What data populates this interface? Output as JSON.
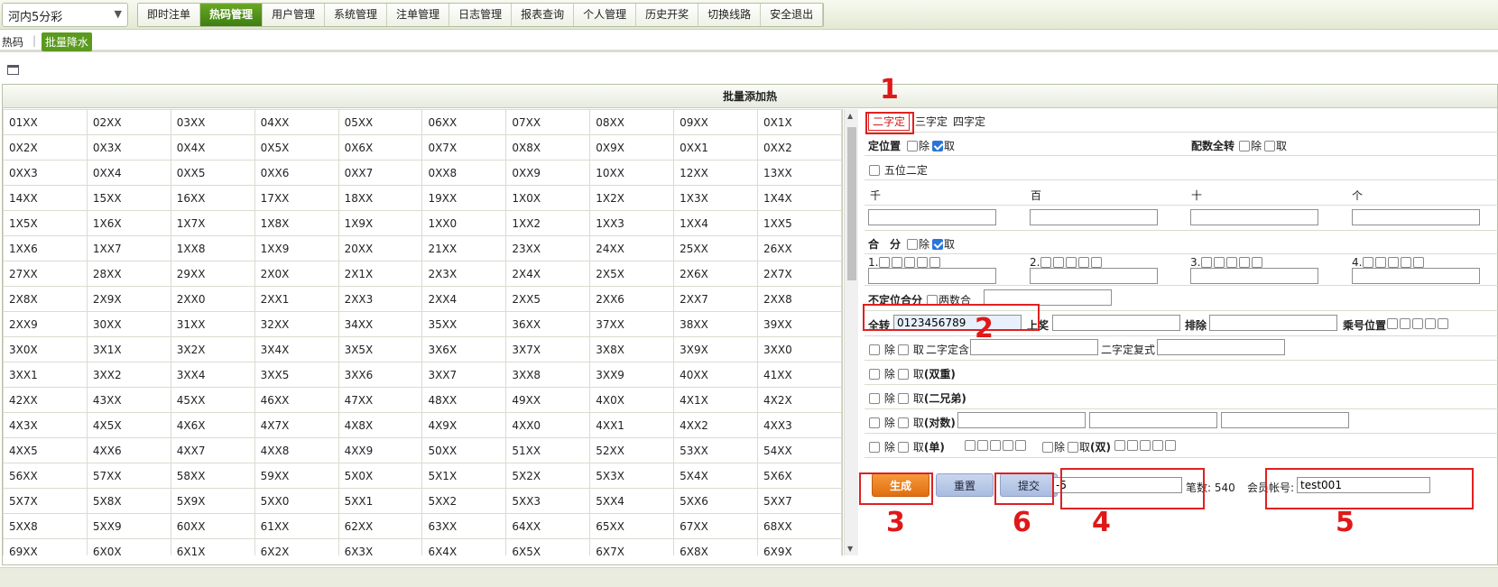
{
  "lottery_select": {
    "value": "河内5分彩"
  },
  "menu": [
    {
      "label": "即时注单",
      "active": false
    },
    {
      "label": "热码管理",
      "active": true
    },
    {
      "label": "用户管理",
      "active": false
    },
    {
      "label": "系统管理",
      "active": false
    },
    {
      "label": "注单管理",
      "active": false
    },
    {
      "label": "日志管理",
      "active": false
    },
    {
      "label": "报表查询",
      "active": false
    },
    {
      "label": "个人管理",
      "active": false
    },
    {
      "label": "历史开奖",
      "active": false
    },
    {
      "label": "切换线路",
      "active": false
    },
    {
      "label": "安全退出",
      "active": false
    }
  ],
  "submenu": {
    "hot": "热码",
    "batch": "批量降水"
  },
  "panel_title": "批量添加热",
  "grid": [
    [
      "01XX",
      "02XX",
      "03XX",
      "04XX",
      "05XX",
      "06XX",
      "07XX",
      "08XX",
      "09XX",
      "0X1X"
    ],
    [
      "0X2X",
      "0X3X",
      "0X4X",
      "0X5X",
      "0X6X",
      "0X7X",
      "0X8X",
      "0X9X",
      "0XX1",
      "0XX2"
    ],
    [
      "0XX3",
      "0XX4",
      "0XX5",
      "0XX6",
      "0XX7",
      "0XX8",
      "0XX9",
      "10XX",
      "12XX",
      "13XX"
    ],
    [
      "14XX",
      "15XX",
      "16XX",
      "17XX",
      "18XX",
      "19XX",
      "1X0X",
      "1X2X",
      "1X3X",
      "1X4X"
    ],
    [
      "1X5X",
      "1X6X",
      "1X7X",
      "1X8X",
      "1X9X",
      "1XX0",
      "1XX2",
      "1XX3",
      "1XX4",
      "1XX5"
    ],
    [
      "1XX6",
      "1XX7",
      "1XX8",
      "1XX9",
      "20XX",
      "21XX",
      "23XX",
      "24XX",
      "25XX",
      "26XX"
    ],
    [
      "27XX",
      "28XX",
      "29XX",
      "2X0X",
      "2X1X",
      "2X3X",
      "2X4X",
      "2X5X",
      "2X6X",
      "2X7X"
    ],
    [
      "2X8X",
      "2X9X",
      "2XX0",
      "2XX1",
      "2XX3",
      "2XX4",
      "2XX5",
      "2XX6",
      "2XX7",
      "2XX8"
    ],
    [
      "2XX9",
      "30XX",
      "31XX",
      "32XX",
      "34XX",
      "35XX",
      "36XX",
      "37XX",
      "38XX",
      "39XX"
    ],
    [
      "3X0X",
      "3X1X",
      "3X2X",
      "3X4X",
      "3X5X",
      "3X6X",
      "3X7X",
      "3X8X",
      "3X9X",
      "3XX0"
    ],
    [
      "3XX1",
      "3XX2",
      "3XX4",
      "3XX5",
      "3XX6",
      "3XX7",
      "3XX8",
      "3XX9",
      "40XX",
      "41XX"
    ],
    [
      "42XX",
      "43XX",
      "45XX",
      "46XX",
      "47XX",
      "48XX",
      "49XX",
      "4X0X",
      "4X1X",
      "4X2X"
    ],
    [
      "4X3X",
      "4X5X",
      "4X6X",
      "4X7X",
      "4X8X",
      "4X9X",
      "4XX0",
      "4XX1",
      "4XX2",
      "4XX3"
    ],
    [
      "4XX5",
      "4XX6",
      "4XX7",
      "4XX8",
      "4XX9",
      "50XX",
      "51XX",
      "52XX",
      "53XX",
      "54XX"
    ],
    [
      "56XX",
      "57XX",
      "58XX",
      "59XX",
      "5X0X",
      "5X1X",
      "5X2X",
      "5X3X",
      "5X4X",
      "5X6X"
    ],
    [
      "5X7X",
      "5X8X",
      "5X9X",
      "5XX0",
      "5XX1",
      "5XX2",
      "5XX3",
      "5XX4",
      "5XX6",
      "5XX7"
    ],
    [
      "5XX8",
      "5XX9",
      "60XX",
      "61XX",
      "62XX",
      "63XX",
      "64XX",
      "65XX",
      "67XX",
      "68XX"
    ],
    [
      "69XX",
      "6X0X",
      "6X1X",
      "6X2X",
      "6X3X",
      "6X4X",
      "6X5X",
      "6X7X",
      "6X8X",
      "6X9X"
    ]
  ],
  "tabs": {
    "two": "二字定",
    "three": "三字定",
    "four": "四字定"
  },
  "fixed_pos": {
    "label": "定位置",
    "exclude": "除",
    "take": "取"
  },
  "pair_all": {
    "label": "配数全转",
    "exclude": "除",
    "take": "取"
  },
  "five_two": "五位二定",
  "positions": {
    "thousand": "千",
    "hundred": "百",
    "ten": "十",
    "unit": "个"
  },
  "sum": {
    "label": "合　分",
    "exclude": "除",
    "take": "取",
    "g1": "1.",
    "g2": "2.",
    "g3": "3.",
    "g4": "4."
  },
  "unfixed_sum": {
    "label": "不定位合分",
    "opt": "两数合"
  },
  "all_turn": {
    "label": "全转",
    "value": "0123456789",
    "upper": "上奖",
    "exclude": "排除",
    "mult_pos": "乘号位置"
  },
  "row_two_contain": {
    "exclude": "除",
    "take": "取",
    "label": "二字定含",
    "label2": "二字定复式"
  },
  "row_double": {
    "exclude": "除",
    "take": "取",
    "label": "(双重)"
  },
  "row_brothers": {
    "exclude": "除",
    "take": "取",
    "label": "(二兄弟)"
  },
  "row_pairs": {
    "exclude": "除",
    "take": "取",
    "label": "(对数)"
  },
  "row_odd": {
    "exclude": "除",
    "take": "取",
    "label": "(单)"
  },
  "row_even": {
    "exclude": "除",
    "take": "取",
    "label": "(双)"
  },
  "actions": {
    "generate": "生成",
    "reset": "重置",
    "submit": "提交"
  },
  "amount": {
    "value": "-5"
  },
  "count": {
    "label": "笔数:",
    "value": "540"
  },
  "member": {
    "label": "会员帐号:",
    "value": "test001"
  },
  "annotations": [
    "1",
    "2",
    "3",
    "4",
    "5",
    "6"
  ]
}
